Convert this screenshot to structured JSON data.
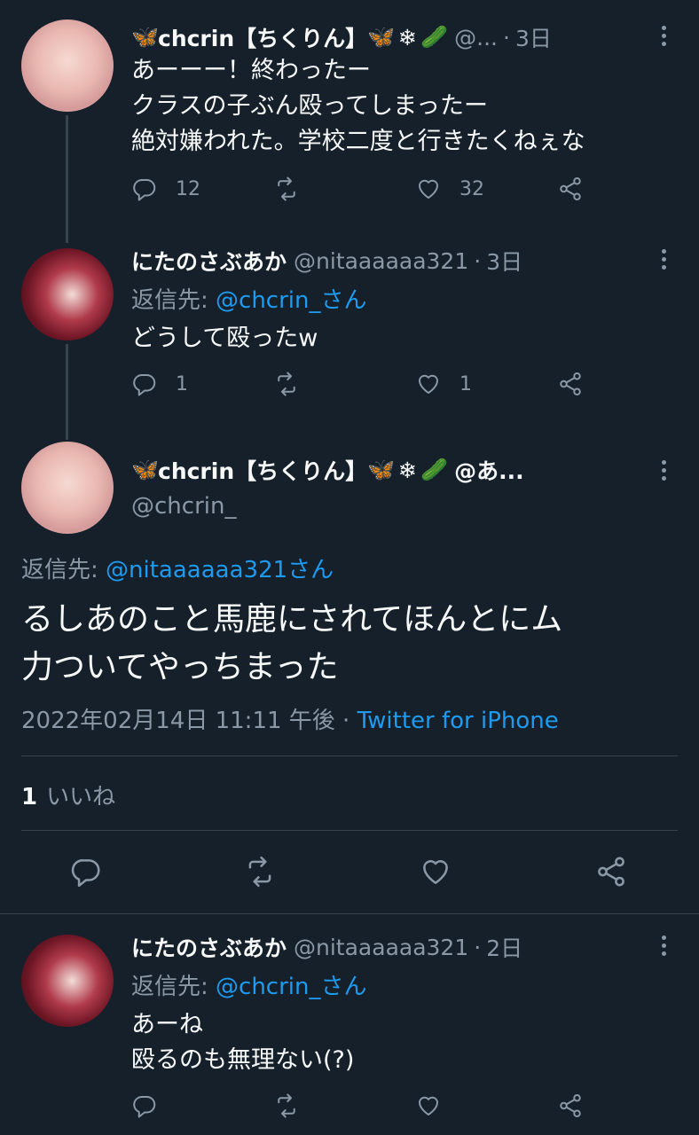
{
  "tweets": [
    {
      "name": "chcrin【ちくりん】",
      "emojis_after": [
        "🦋",
        "❄",
        "🥒"
      ],
      "emojis_before": [
        "🦋"
      ],
      "handle": "@...",
      "time": "3日",
      "lines": [
        "あーーー！終わったー",
        "クラスの子ぶん殴ってしまったー",
        "絶対嫌われた。学校二度と行きたくねぇな"
      ],
      "reply_count": "12",
      "retweet_count": "",
      "like_count": "32"
    },
    {
      "name": "にたのさぶあか",
      "handle": "@nitaaaaaa321",
      "time": "3日",
      "reply_prefix": "返信先: ",
      "reply_mention": "@chcrin_さん",
      "lines": [
        "どうして殴ったw"
      ],
      "reply_count": "1",
      "retweet_count": "",
      "like_count": "1"
    }
  ],
  "main": {
    "name": "chcrin【ちくりん】",
    "emojis_before": [
      "🦋"
    ],
    "emojis_after": [
      "🦋",
      "❄",
      "🥒"
    ],
    "name_suffix": "@あ...",
    "handle": "@chcrin_",
    "reply_prefix": "返信先: ",
    "reply_mention": "@nitaaaaaa321さん",
    "lines": [
      "るしあのこと馬鹿にされてほんとにム",
      "力ついてやっちまった"
    ],
    "timestamp": "2022年02月14日 11:11 午後",
    "separator": " · ",
    "source": "Twitter for iPhone",
    "likes_count": "1",
    "likes_label": "いいね"
  },
  "reply": {
    "name": "にたのさぶあか",
    "handle": "@nitaaaaaa321",
    "time": "2日",
    "reply_prefix": "返信先: ",
    "reply_mention": "@chcrin_さん",
    "lines": [
      "あーね",
      "殴るのも無理ない(?)"
    ]
  },
  "dot_sep": "·",
  "colors": {
    "background": "#15202b",
    "text": "#f7f9f9",
    "secondary": "#8b98a5",
    "accent": "#1d9bf0",
    "border": "#38444d"
  },
  "icons": [
    "reply-icon",
    "retweet-icon",
    "like-icon",
    "share-icon",
    "more-icon"
  ]
}
